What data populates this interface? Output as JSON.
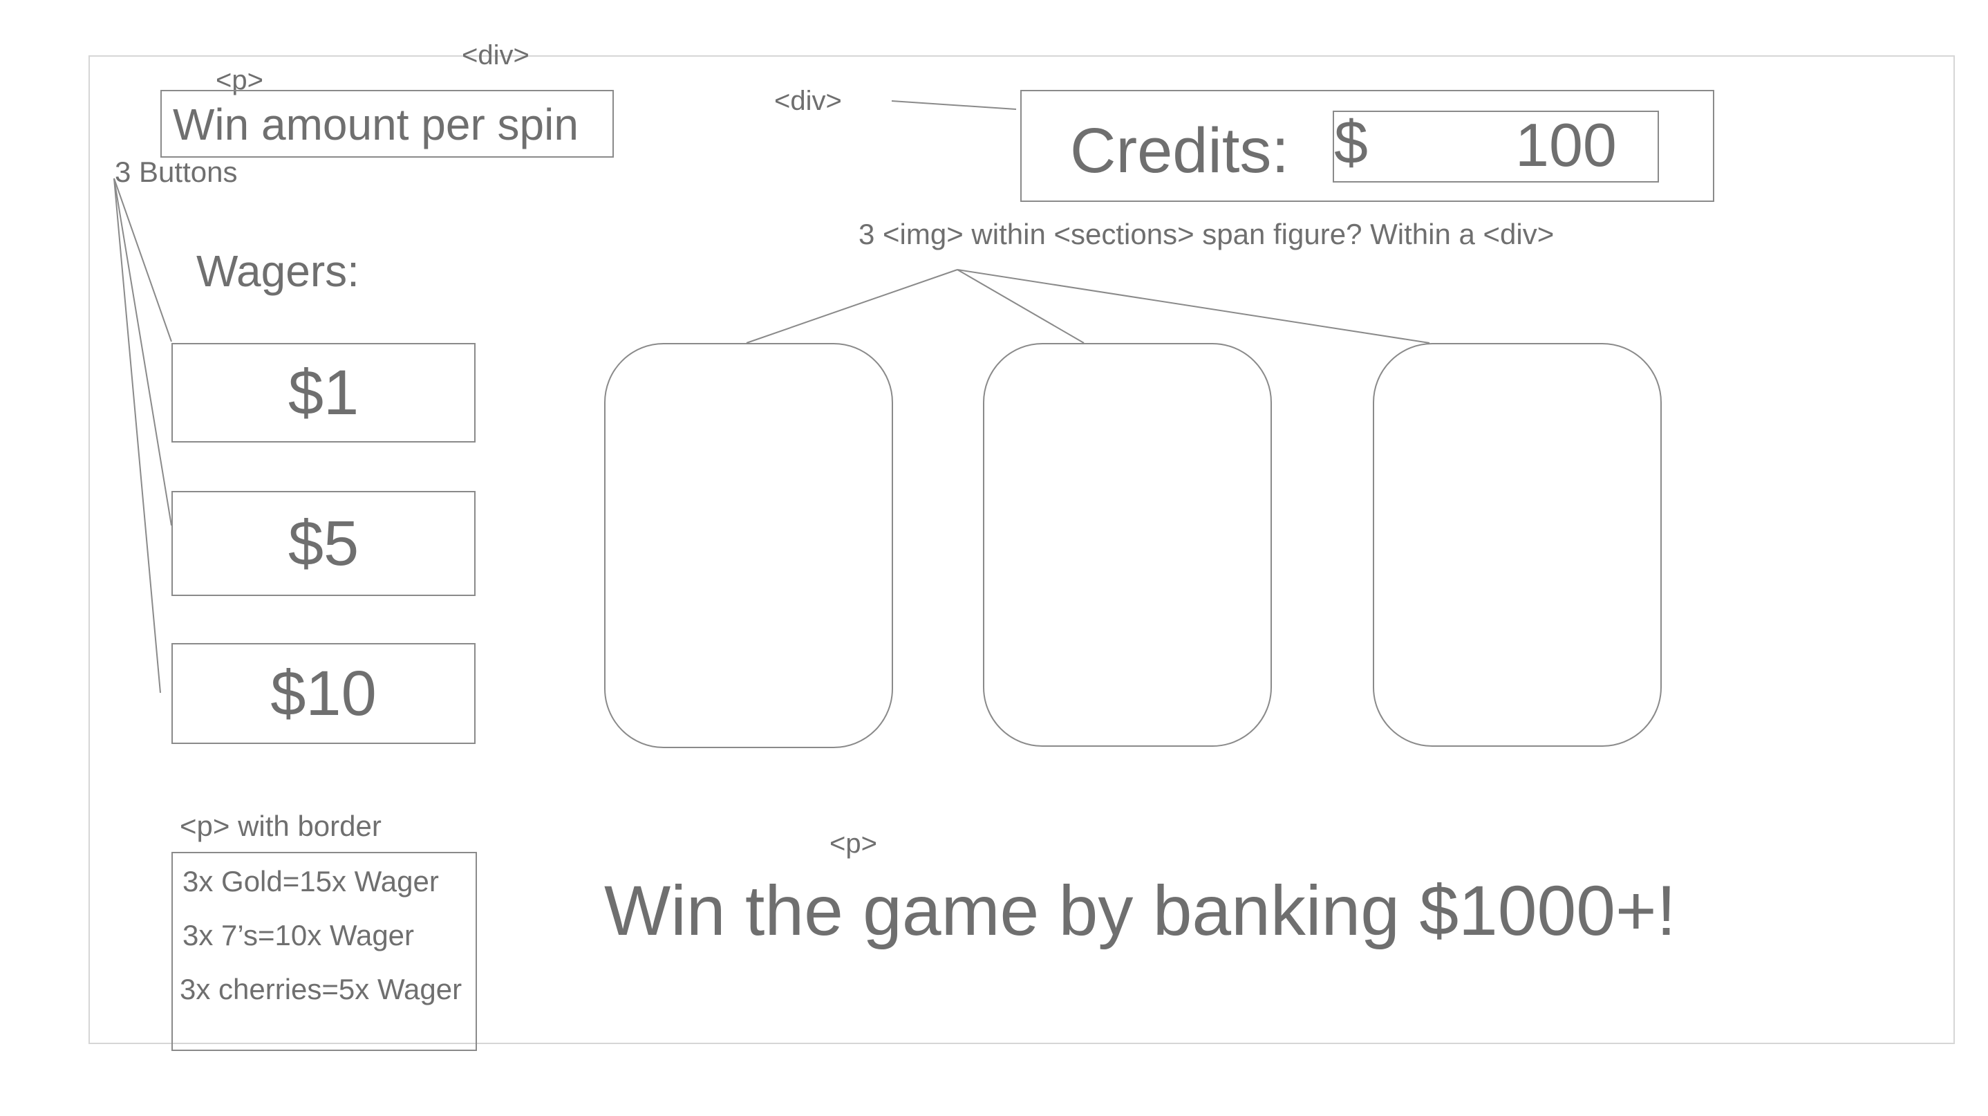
{
  "annotations": {
    "div_top": "<div>",
    "p_top": "<p>",
    "div_credits": "<div>",
    "three_buttons": "3 Buttons",
    "images_note": "3 <img> within <sections> span figure? Within a <div>",
    "p_border_note": "<p> with border",
    "p_bottom": "<p>"
  },
  "win_amount": {
    "label": "Win amount per spin"
  },
  "credits": {
    "label": "Credits:",
    "currency": "$",
    "value": "100"
  },
  "wagers": {
    "heading": "Wagers:",
    "buttons": [
      "$1",
      "$5",
      "$10"
    ]
  },
  "reels": {
    "count": 3
  },
  "paytable": {
    "lines": [
      "3x Gold=15x Wager",
      "3x 7’s=10x Wager",
      "3x cherries=5x Wager"
    ]
  },
  "goal": {
    "text": "Win the game by banking $1000+!"
  },
  "colors": {
    "text": "#6f6f6f",
    "border": "#8a8a8a",
    "frame": "#d6d6d6"
  }
}
